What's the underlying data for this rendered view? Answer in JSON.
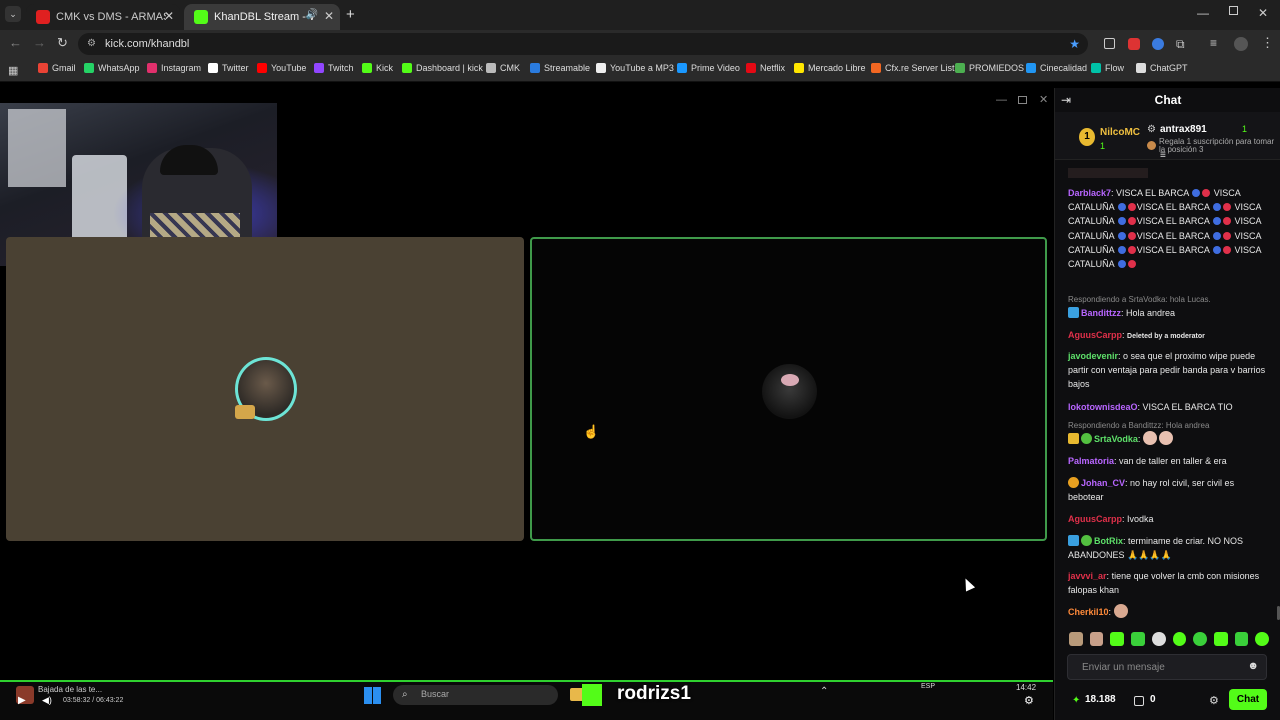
{
  "browser": {
    "tabs": [
      {
        "title": "CMK vs DMS - ARMAS LARGAS",
        "active": false,
        "favicon_color": "#e02020"
      },
      {
        "title": "KhanDBL Stream - Watch Li",
        "active": true,
        "favicon_color": "#53fc18"
      }
    ],
    "new_tab": "+",
    "url": "kick.com/khandbl",
    "bookmarks": [
      {
        "label": "Gmail",
        "color": "#ea4335"
      },
      {
        "label": "WhatsApp",
        "color": "#25d366"
      },
      {
        "label": "Instagram",
        "color": "#e1306c"
      },
      {
        "label": "Twitter",
        "color": "#ffffff"
      },
      {
        "label": "YouTube",
        "color": "#ff0000"
      },
      {
        "label": "Twitch",
        "color": "#9146ff"
      },
      {
        "label": "Kick",
        "color": "#53fc18"
      },
      {
        "label": "Dashboard | kick",
        "color": "#53fc18"
      },
      {
        "label": "CMK",
        "color": "#bbbbbb"
      },
      {
        "label": "Streamable",
        "color": "#2a7bde"
      },
      {
        "label": "YouTube a MP3",
        "color": "#eeeeee"
      },
      {
        "label": "Prime Video",
        "color": "#1a98ff"
      },
      {
        "label": "Netflix",
        "color": "#e50914"
      },
      {
        "label": "Mercado Libre",
        "color": "#ffe600"
      },
      {
        "label": "Cfx.re Server List",
        "color": "#f26722"
      },
      {
        "label": "PROMIEDOS",
        "color": "#4caf50"
      },
      {
        "label": "Cinecalidad",
        "color": "#2196f3"
      },
      {
        "label": "Flow",
        "color": "#00c2a8"
      },
      {
        "label": "ChatGPT",
        "color": "#dddddd"
      }
    ]
  },
  "stream": {
    "taskbar": {
      "media_title": "Bajada de las te...",
      "media_time": "03:58:32 / 06:43:22",
      "search_placeholder": "Buscar",
      "overlay_name": "rodrizs1",
      "lang": "ESP",
      "time": "14:42"
    }
  },
  "chat": {
    "header": "Chat",
    "leaderboard": {
      "first_rank": "1",
      "first_name": "NilcoMC",
      "first_count": "1",
      "second_name": "antrax891",
      "second_count": "1",
      "gift_note": "Regala 1 suscripción para tomar la posición 3"
    },
    "messages": [
      {
        "user": "Darblack7",
        "text": "VISCA EL BARCA",
        "text2": "VISCA CATALUÑA",
        "color": "#b866ff"
      },
      {
        "reply": "Respondiendo a SrtaVodka: hola Lucas.",
        "user": "Bandittzz",
        "text": "Hola andrea",
        "color": "#b866ff"
      },
      {
        "user": "AguusCarpp",
        "text": "Deleted by a moderator",
        "color": "#e0304a"
      },
      {
        "user": "javodevenir",
        "text": "o sea que el proximo wipe puede partir con ventaja para pedir banda para v barrios bajos",
        "color": "#5ee06a"
      },
      {
        "user": "lokotownisdeaO",
        "text": "VISCA EL BARCA TIO",
        "color": "#b866ff"
      },
      {
        "reply": "Respondiendo a Bandittzz: Hola andrea",
        "user": "SrtaVodka",
        "text": "",
        "color": "#5ee06a"
      },
      {
        "user": "Palmatoria",
        "text": "van de taller en taller & era",
        "color": "#b866ff"
      },
      {
        "user": "Johan_CV",
        "text": "no hay rol civil, ser civil es bebotear",
        "color": "#b866ff"
      },
      {
        "user": "AguusCarpp",
        "text": "Ivodka",
        "color": "#e0304a"
      },
      {
        "user": "BotRix",
        "text": "terminame de criar. NO NOS ABANDONES 🙏🙏🙏🙏",
        "color": "#5ee06a"
      },
      {
        "user": "javvvi_ar",
        "text": "tiene que volver la cmb con misiones falopas khan",
        "color": "#e0304a"
      },
      {
        "user": "Cherkil10",
        "text": "",
        "color": "#ff8a3a"
      }
    ],
    "input_placeholder": "Enviar un mensaje",
    "viewer_count": "18.188",
    "points": "0",
    "send_button": "Chat"
  }
}
